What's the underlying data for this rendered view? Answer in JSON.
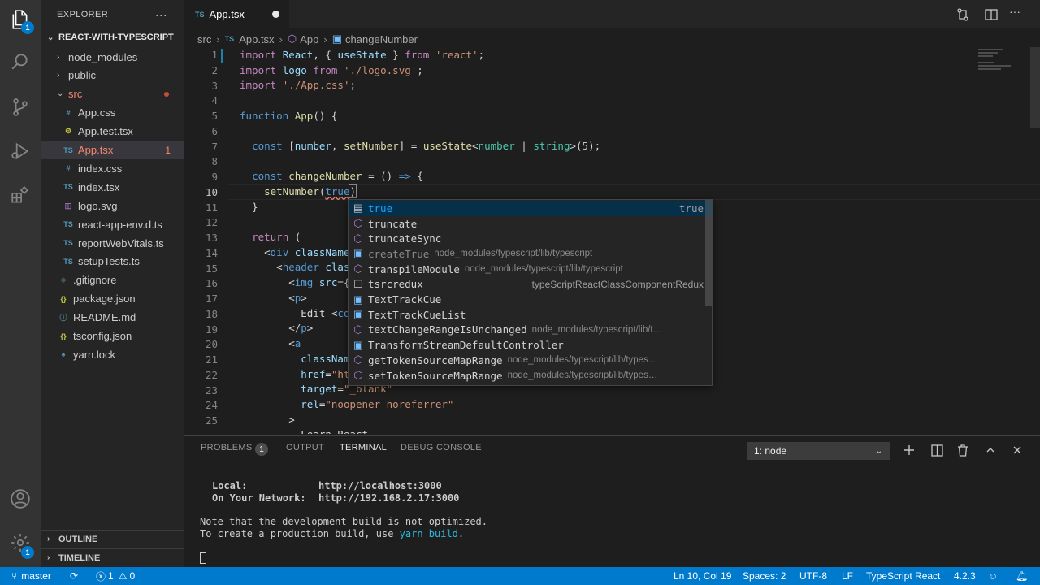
{
  "explorer": {
    "title": "EXPLORER",
    "project": "REACT-WITH-TYPESCRIPT",
    "items": [
      {
        "label": "node_modules",
        "kind": "folder",
        "depth": 1
      },
      {
        "label": "public",
        "kind": "folder",
        "depth": 1
      },
      {
        "label": "src",
        "kind": "folder-open",
        "depth": 1
      },
      {
        "label": "App.css",
        "kind": "css",
        "depth": 2
      },
      {
        "label": "App.test.tsx",
        "kind": "test",
        "depth": 2
      },
      {
        "label": "App.tsx",
        "kind": "ts",
        "depth": 2,
        "badge": "1"
      },
      {
        "label": "index.css",
        "kind": "css",
        "depth": 2
      },
      {
        "label": "index.tsx",
        "kind": "ts",
        "depth": 2
      },
      {
        "label": "logo.svg",
        "kind": "svg",
        "depth": 2
      },
      {
        "label": "react-app-env.d.ts",
        "kind": "ts",
        "depth": 2
      },
      {
        "label": "reportWebVitals.ts",
        "kind": "ts",
        "depth": 2
      },
      {
        "label": "setupTests.ts",
        "kind": "ts",
        "depth": 2
      },
      {
        "label": ".gitignore",
        "kind": "git",
        "depth": 1
      },
      {
        "label": "package.json",
        "kind": "json",
        "depth": 1
      },
      {
        "label": "README.md",
        "kind": "md",
        "depth": 1
      },
      {
        "label": "tsconfig.json",
        "kind": "json",
        "depth": 1
      },
      {
        "label": "yarn.lock",
        "kind": "yarn",
        "depth": 1
      }
    ],
    "outline": "OUTLINE",
    "timeline": "TIMELINE"
  },
  "tab": {
    "icon": "TS",
    "label": "App.tsx"
  },
  "breadcrumb": {
    "folder": "src",
    "file_icon": "TS",
    "file": "App.tsx",
    "symbol1": "App",
    "symbol2": "changeNumber"
  },
  "editor": {
    "line_numbers": [
      "1",
      "2",
      "3",
      "4",
      "5",
      "6",
      "7",
      "8",
      "9",
      "10",
      "11",
      "12",
      "13",
      "14",
      "15",
      "16",
      "17",
      "18",
      "19",
      "20",
      "21",
      "22",
      "23",
      "24",
      "25"
    ]
  },
  "suggest": {
    "items": [
      {
        "label": "true",
        "detail": "",
        "right": "true",
        "icon": "keyword"
      },
      {
        "label": "truncate",
        "detail": "",
        "right": "",
        "icon": "method"
      },
      {
        "label": "truncateSync",
        "detail": "",
        "right": "",
        "icon": "method"
      },
      {
        "label": "createTrue",
        "detail": "node_modules/typescript/lib/typescript",
        "right": "",
        "icon": "field"
      },
      {
        "label": "transpileModule",
        "detail": "node_modules/typescript/lib/typescript",
        "right": "",
        "icon": "method"
      },
      {
        "label": "tsrcredux",
        "detail": "",
        "right": "typeScriptReactClassComponentRedux",
        "icon": "snippet"
      },
      {
        "label": "TextTrackCue",
        "detail": "",
        "right": "",
        "icon": "field"
      },
      {
        "label": "TextTrackCueList",
        "detail": "",
        "right": "",
        "icon": "field"
      },
      {
        "label": "textChangeRangeIsUnchanged",
        "detail": "node_modules/typescript/lib/t…",
        "right": "",
        "icon": "method"
      },
      {
        "label": "TransformStreamDefaultController",
        "detail": "",
        "right": "",
        "icon": "field"
      },
      {
        "label": "getTokenSourceMapRange",
        "detail": "node_modules/typescript/lib/types…",
        "right": "",
        "icon": "method"
      },
      {
        "label": "setTokenSourceMapRange",
        "detail": "node_modules/typescript/lib/types…",
        "right": "",
        "icon": "method"
      }
    ]
  },
  "panel": {
    "tabs": {
      "problems": "PROBLEMS",
      "problems_count": "1",
      "output": "OUTPUT",
      "terminal": "TERMINAL",
      "debug": "DEBUG CONSOLE"
    },
    "terminal_select": "1: node",
    "terminal_lines": {
      "local_label": "Local:",
      "local_url": "http://localhost:3000",
      "net_label": "On Your Network:",
      "net_url": "http://192.168.2.17:3000",
      "note": "Note that the development build is not optimized.",
      "prod_pre": "To create a production build, use ",
      "prod_cmd": "yarn build",
      "prod_post": "."
    }
  },
  "status": {
    "branch": "master",
    "problems_errors": "1",
    "problems_warnings": "0",
    "position": "Ln 10, Col 19",
    "spaces": "Spaces: 2",
    "encoding": "UTF-8",
    "eol": "LF",
    "language": "TypeScript React",
    "version": "4.2.3"
  },
  "activity": {
    "explorer_badge": "1",
    "settings_badge": "1"
  },
  "colors": {
    "accent": "#007acc",
    "ts_icon": "#519aba",
    "error": "#f48771"
  }
}
